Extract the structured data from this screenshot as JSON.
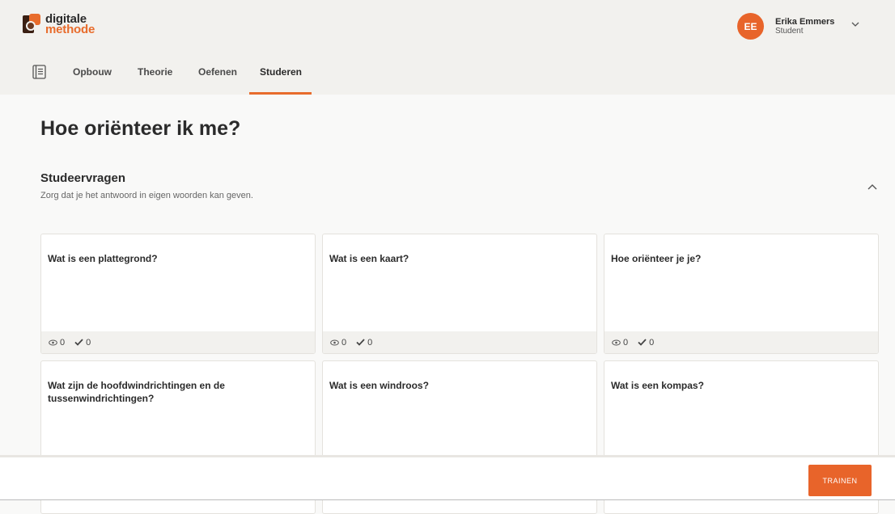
{
  "brand": {
    "line1": "digitale",
    "line2": "methode"
  },
  "user": {
    "initials": "EE",
    "name": "Erika Emmers",
    "role": "Student"
  },
  "nav": {
    "tabs": [
      {
        "label": "Opbouw"
      },
      {
        "label": "Theorie"
      },
      {
        "label": "Oefenen"
      },
      {
        "label": "Studeren"
      }
    ],
    "active": "Studeren"
  },
  "page": {
    "title": "Hoe oriënteer ik me?",
    "section_title": "Studeervragen",
    "section_subtitle": "Zorg dat je het antwoord in eigen woorden kan geven."
  },
  "cards": [
    {
      "question": "Wat is een plattegrond?",
      "views": "0",
      "checks": "0"
    },
    {
      "question": "Wat is een kaart?",
      "views": "0",
      "checks": "0"
    },
    {
      "question": "Hoe oriënteer je je?",
      "views": "0",
      "checks": "0"
    },
    {
      "question": "Wat zijn de hoofdwindrichtingen en de tussenwindrichtingen?"
    },
    {
      "question": "Wat is een windroos?"
    },
    {
      "question": "Wat is een kompas?"
    }
  ],
  "actions": {
    "train_label": "TRAINEN"
  },
  "colors": {
    "accent": "#e86c2c",
    "header_bg": "#f2f1ee"
  }
}
